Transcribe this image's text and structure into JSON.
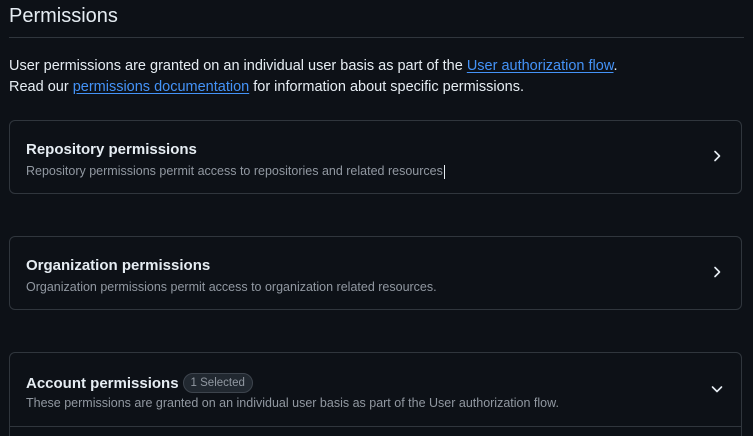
{
  "section": {
    "title": "Permissions",
    "intro_line1_prefix": "User permissions are granted on an individual user basis as part of the ",
    "intro_line1_link": "User authorization flow",
    "intro_line1_suffix": ".",
    "intro_line2_prefix": "Read our ",
    "intro_line2_link": "permissions documentation",
    "intro_line2_suffix": " for information about specific permissions."
  },
  "cards": [
    {
      "title": "Repository permissions",
      "subtitle": "Repository permissions permit access to repositories and related resources",
      "state": "collapsed",
      "icon": "chevron-right-icon"
    },
    {
      "title": "Organization permissions",
      "subtitle": "Organization permissions permit access to organization related resources.",
      "state": "collapsed",
      "icon": "chevron-right-icon"
    },
    {
      "title": "Account permissions",
      "badge": "1 Selected",
      "subtitle": "These permissions are granted on an individual user basis as part of the User authorization flow.",
      "state": "expanded",
      "icon": "chevron-down-icon"
    }
  ],
  "colors": {
    "background": "#0d1117",
    "border": "#30363d",
    "text": "#e6edf3",
    "muted": "#9198a1",
    "link": "#4493f8"
  }
}
